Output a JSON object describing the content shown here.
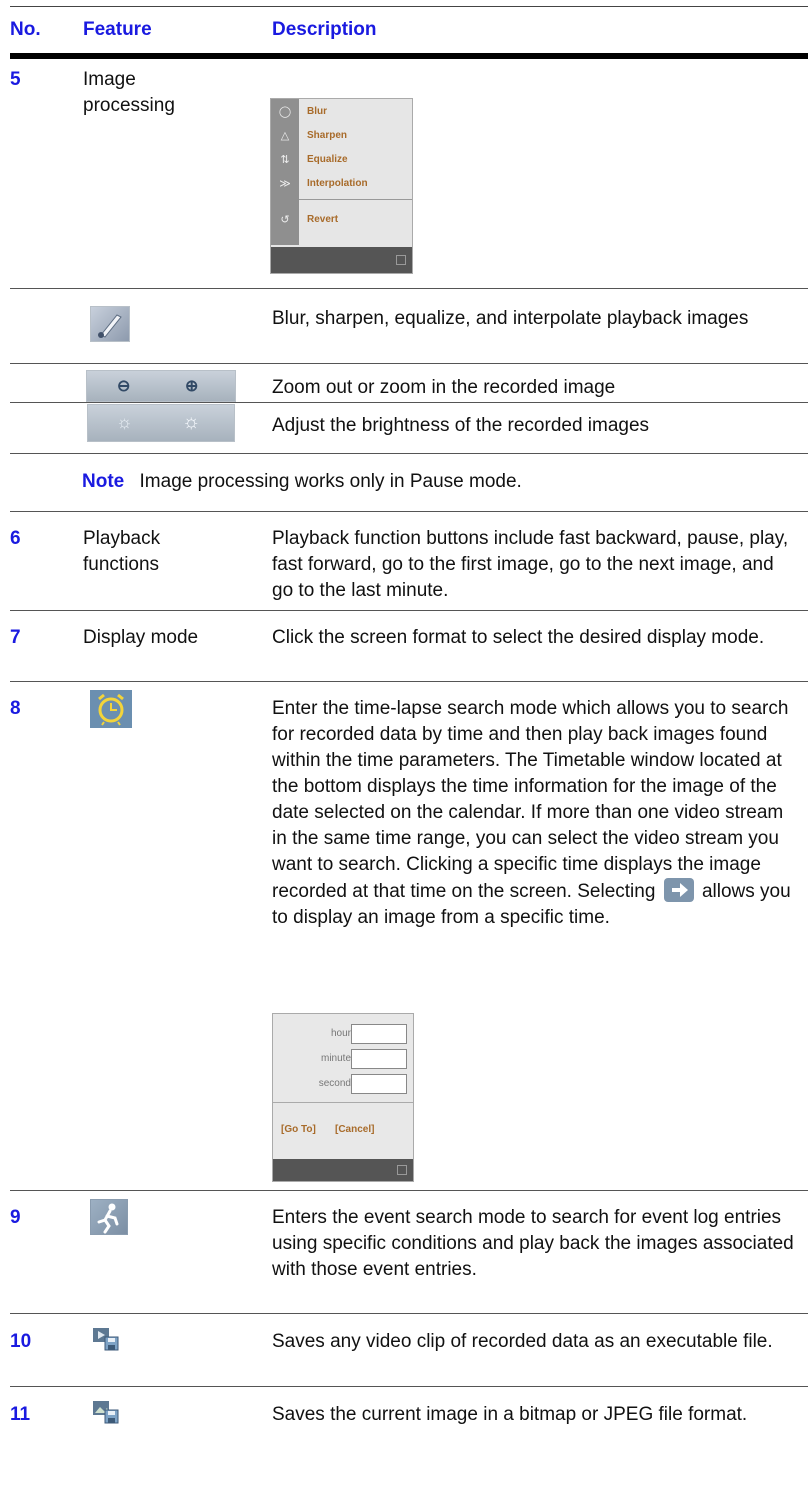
{
  "header": {
    "no": "No.",
    "feature": "Feature",
    "description": "Description"
  },
  "rows": {
    "r5": {
      "no": "5",
      "feature": "Image processing"
    },
    "menu": {
      "items": [
        "Blur",
        "Sharpen",
        "Equalize",
        "Interpolation",
        "Revert"
      ]
    },
    "brush": {
      "desc": "Blur, sharpen, equalize, and interpolate playback images",
      "icon": "brush-icon"
    },
    "zoom": {
      "desc": "Zoom out or zoom in the recorded image",
      "icons": [
        "zoom-out-icon",
        "zoom-in-icon"
      ]
    },
    "brightness": {
      "desc": "Adjust the brightness of the recorded images",
      "icons": [
        "brightness-down-icon",
        "brightness-up-icon"
      ]
    },
    "note": {
      "label": "Note",
      "text": "Image processing works only in Pause mode."
    },
    "r6": {
      "no": "6",
      "feature": "Playback functions",
      "desc": "Playback function buttons include fast backward, pause, play, fast forward, go to the first image, go to the next image, and go to the last minute."
    },
    "r7": {
      "no": "7",
      "feature": "Display mode",
      "desc": "Click the screen format to select the desired display mode."
    },
    "r8": {
      "no": "8",
      "icon": "alarm-clock-icon",
      "desc_main": "Enter the time-lapse search mode which allows you to search for recorded data by time and then play back images found within the time parameters. The Timetable window located at the bottom displays the time information for the image of the date selected on the calendar. If more than one video stream in the same time range, you can select the video stream you want to search. Clicking a specific time displays the image recorded at that time on the screen.",
      "desc_select_pre": "Selecting",
      "desc_select_post": "allows you to display an image from a specific time.",
      "goto": {
        "hour": "hour",
        "minute": "minute",
        "second": "second",
        "go": "[Go To]",
        "cancel": "[Cancel]"
      }
    },
    "r9": {
      "no": "9",
      "icon": "running-man-icon",
      "desc": "Enters the event search mode to search for event log entries using specific conditions and play back the images associated with those event entries."
    },
    "r10": {
      "no": "10",
      "icon": "save-clip-icon",
      "desc": "Saves any video clip of recorded data as an executable file."
    },
    "r11": {
      "no": "11",
      "icon": "save-image-icon",
      "desc": "Saves the current image in a bitmap or JPEG file format."
    }
  },
  "colors": {
    "accent": "#1a1ae0"
  }
}
